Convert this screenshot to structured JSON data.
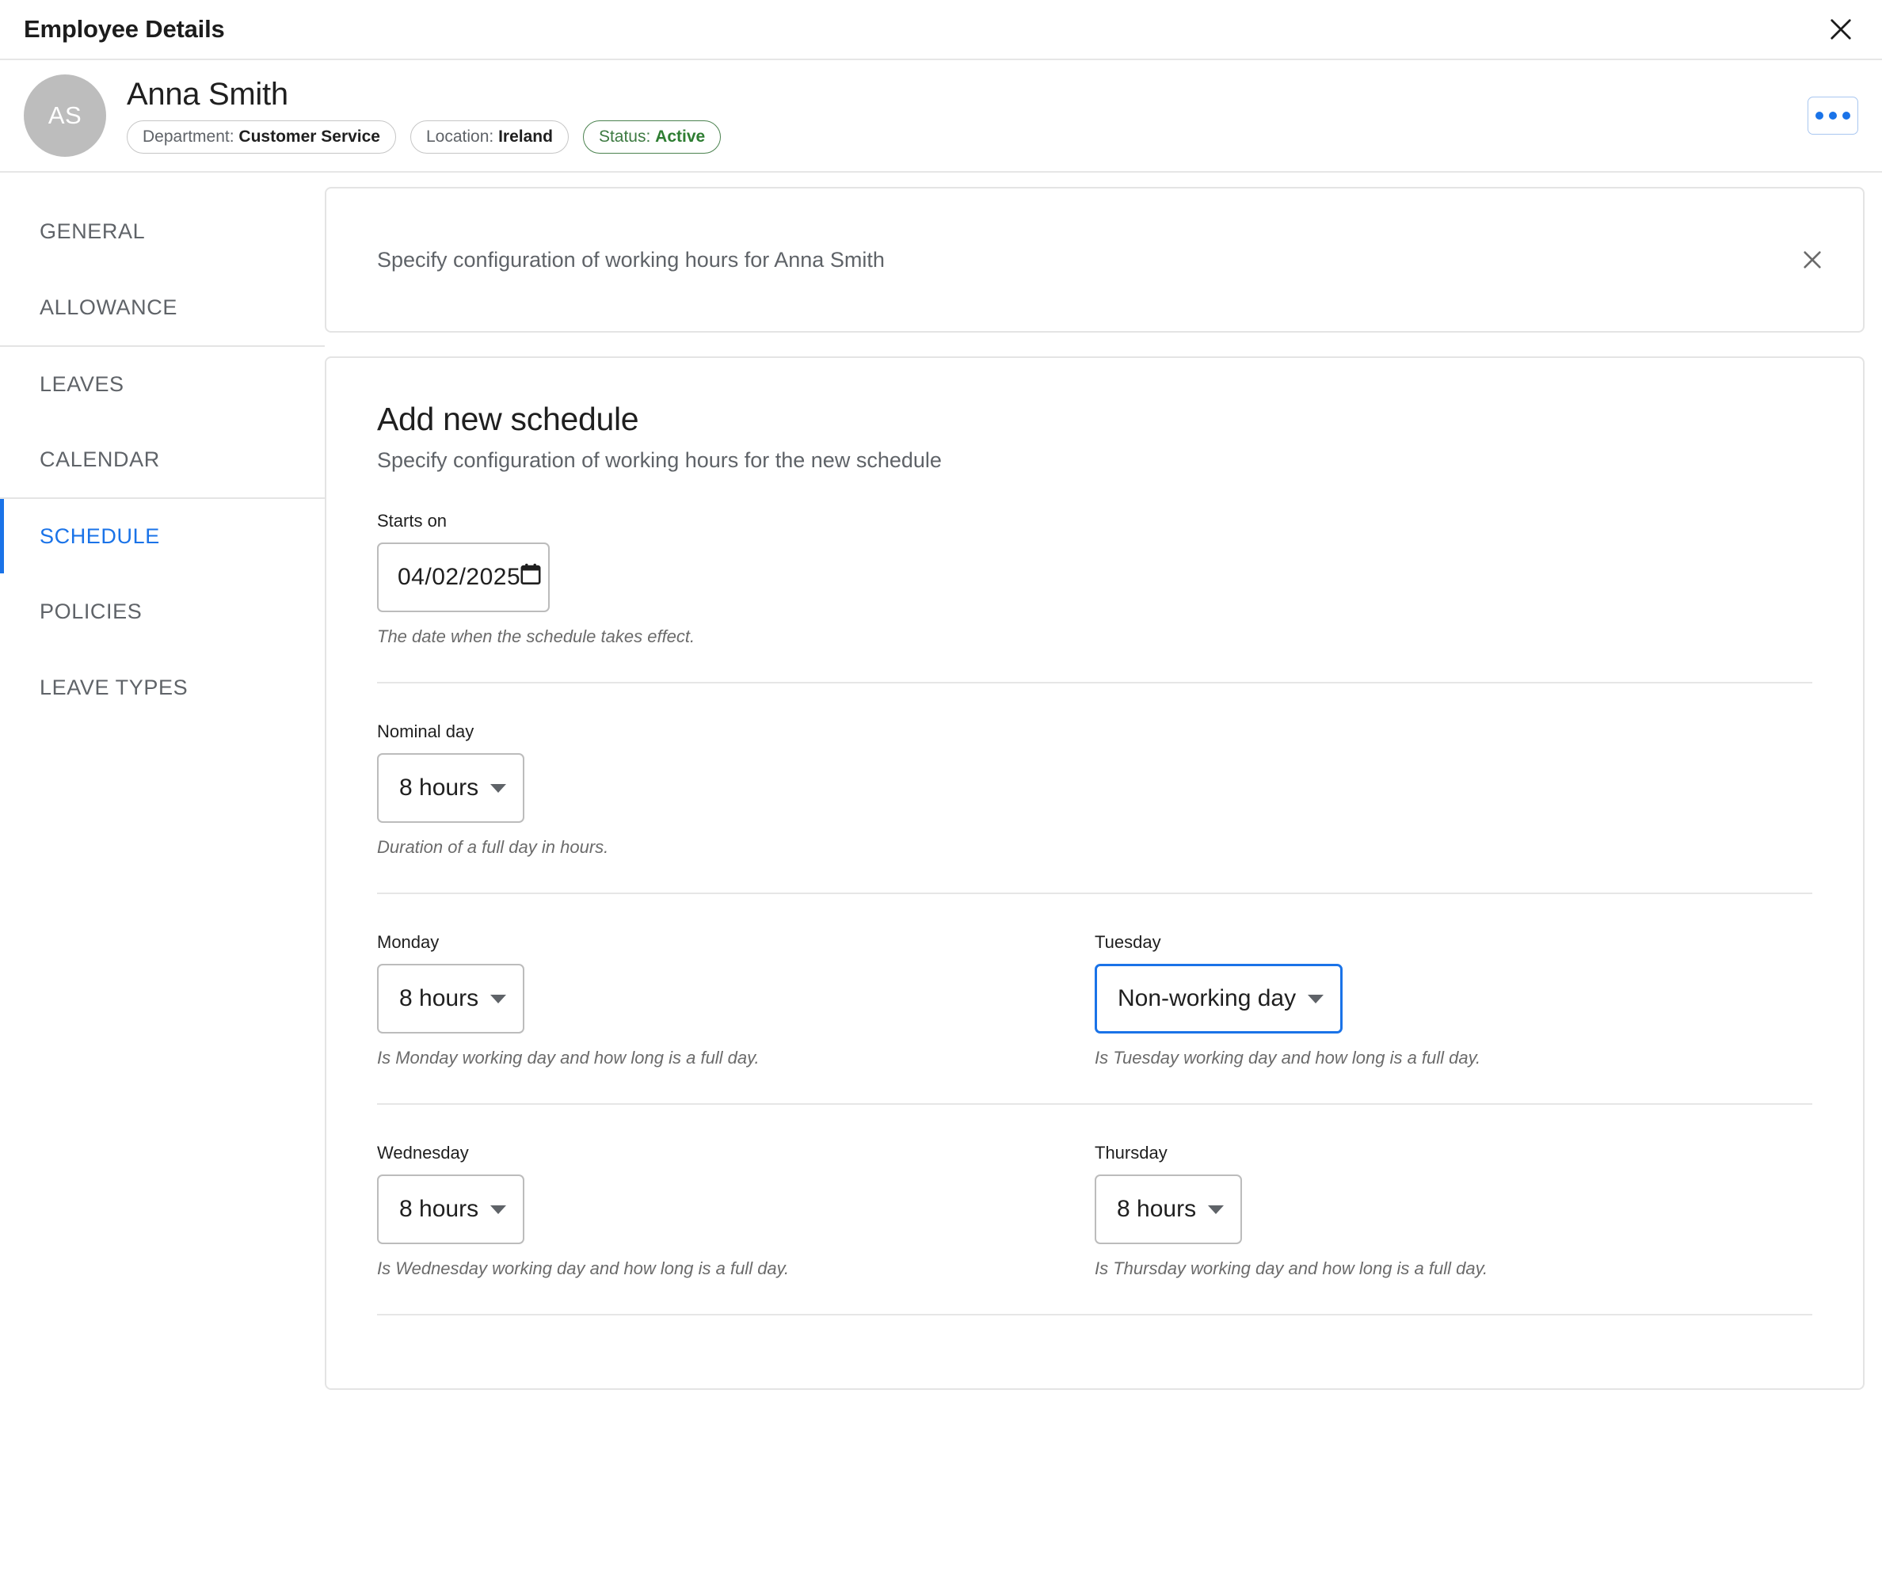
{
  "titlebar": {
    "title": "Employee Details",
    "close_icon": "close-icon"
  },
  "employee": {
    "initials": "AS",
    "name": "Anna Smith",
    "pills": [
      {
        "label": "Department:",
        "value": "Customer Service",
        "variant": "default"
      },
      {
        "label": "Location:",
        "value": "Ireland",
        "variant": "default"
      },
      {
        "label": "Status:",
        "value": "Active",
        "variant": "status"
      }
    ],
    "more_button_icon": "ellipsis-icon"
  },
  "sidebar": {
    "items": [
      {
        "label": "GENERAL",
        "active": false,
        "divider_above": false
      },
      {
        "label": "ALLOWANCE",
        "active": false,
        "divider_above": false
      },
      {
        "label": "LEAVES",
        "active": false,
        "divider_above": true
      },
      {
        "label": "CALENDAR",
        "active": false,
        "divider_above": false
      },
      {
        "label": "SCHEDULE",
        "active": true,
        "divider_above": true
      },
      {
        "label": "POLICIES",
        "active": false,
        "divider_above": false
      },
      {
        "label": "LEAVE TYPES",
        "active": false,
        "divider_above": false
      }
    ]
  },
  "banner": {
    "text": "Specify configuration of working hours for Anna Smith",
    "close_icon": "close-icon"
  },
  "form": {
    "title": "Add new schedule",
    "subtitle": "Specify configuration of working hours for the new schedule",
    "starts_on": {
      "label": "Starts on",
      "value": "04/02/2025",
      "hint": "The date when the schedule takes effect.",
      "icon": "calendar-icon"
    },
    "nominal_day": {
      "label": "Nominal day",
      "value": "8 hours",
      "hint": "Duration of a full day in hours."
    },
    "days": [
      {
        "label": "Monday",
        "value": "8 hours",
        "hint": "Is Monday working day and how long is a full day.",
        "focused": false
      },
      {
        "label": "Tuesday",
        "value": "Non-working day",
        "hint": "Is Tuesday working day and how long is a full day.",
        "focused": true
      },
      {
        "label": "Wednesday",
        "value": "8 hours",
        "hint": "Is Wednesday working day and how long is a full day.",
        "focused": false
      },
      {
        "label": "Thursday",
        "value": "8 hours",
        "hint": "Is Thursday working day and how long is a full day.",
        "focused": false
      }
    ]
  },
  "colors": {
    "accent": "#1a73e8",
    "status_green": "#2e7d32",
    "muted_text": "#5f6368",
    "border": "#e4e4e4"
  }
}
